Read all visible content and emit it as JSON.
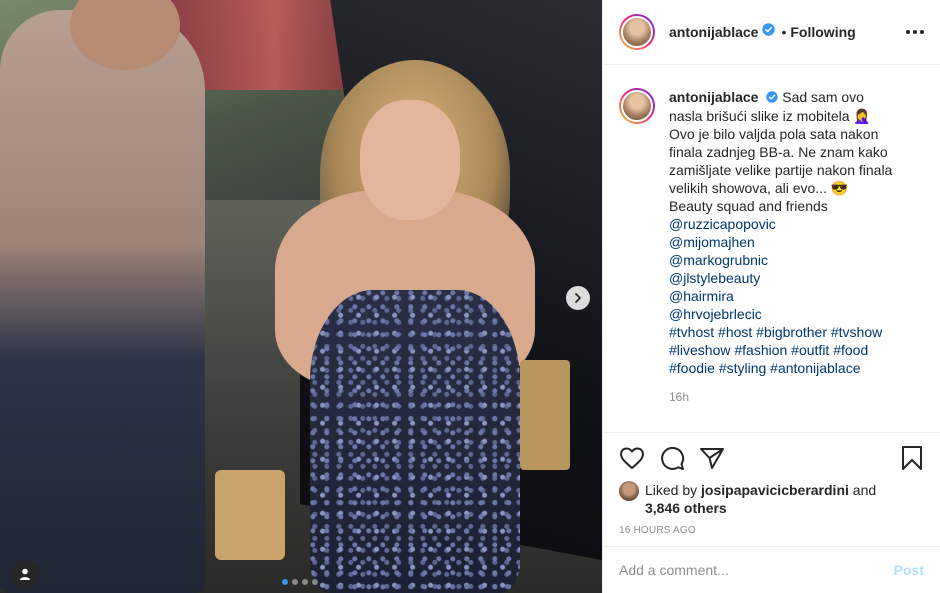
{
  "post": {
    "username": "antonijablace",
    "follow_separator": "•",
    "follow_status": "Following",
    "carousel_position": {
      "current": 1,
      "total": 4
    },
    "colors": {
      "accent_blue": "#3897f0",
      "link": "#00376b",
      "muted": "#8e8e8e",
      "post_disabled": "#b2dffc"
    }
  },
  "caption": {
    "username": "antonijablace",
    "line1": "Sad sam ovo nasla brišući slike iz mobitela 🤦‍♀️",
    "line2": "Ovo je bilo valjda pola sata nakon finala zadnjeg BB-a. Ne znam kako zamišljate velike partije nakon finala velikih showova, ali evo... 😎",
    "line3": "Beauty squad and friends",
    "mentions": [
      "@ruzzicapopovic",
      "@mijomajhen",
      "@markogrubnic",
      "@jlstylebeauty",
      "@hairmira",
      "@hrvojebrlecic"
    ],
    "hashtags_line1": "#tvhost #host #bigbrother #tvshow",
    "hashtags_line2": "#liveshow #fashion #outfit #food",
    "hashtags_line3": "#foodie #styling #antonijablace",
    "time": "16h"
  },
  "likes": {
    "prefix": "Liked by",
    "user": "josipapavicicberardini",
    "conj": "and",
    "others": "3,846 others"
  },
  "timestamp": "16 HOURS AGO",
  "comment_box": {
    "placeholder": "Add a comment...",
    "post_label": "Post"
  },
  "icons": [
    "heart-icon",
    "comment-icon",
    "share-icon",
    "bookmark-icon",
    "more-icon",
    "verified-icon",
    "chevron-right-icon",
    "user-tag-icon"
  ]
}
